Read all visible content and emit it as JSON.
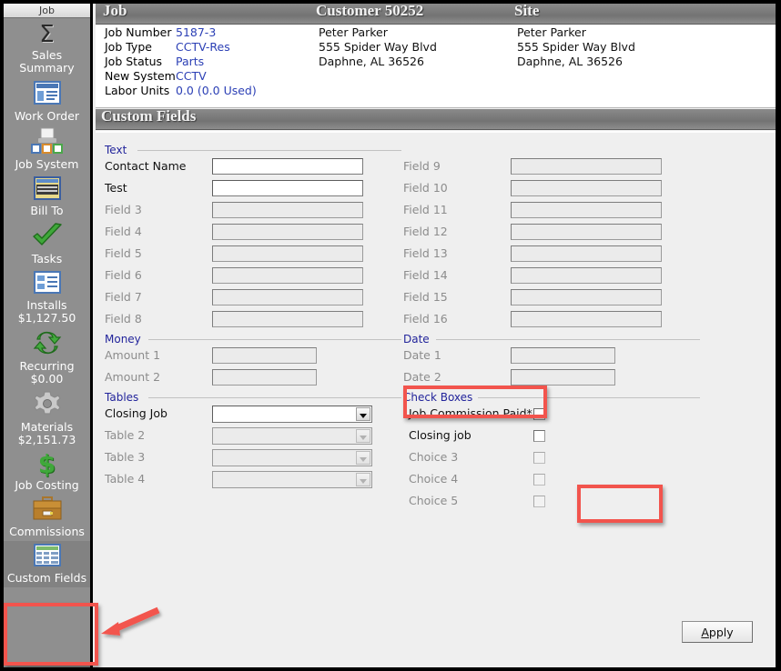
{
  "window": {
    "accent_red": "#f2544d",
    "link_blue": "#2b3fb5",
    "group_blue": "#22249b",
    "sidebar_bg": "#8f8f8f"
  },
  "sidebar": {
    "tab_label": "Job",
    "items": [
      {
        "label": "Sales Summary",
        "sub": "",
        "icon": "sigma-icon",
        "selected": false
      },
      {
        "label": "Work Order",
        "sub": "",
        "icon": "work-order-icon",
        "selected": false
      },
      {
        "label": "Job System",
        "sub": "",
        "icon": "job-system-icon",
        "selected": false
      },
      {
        "label": "Bill To",
        "sub": "",
        "icon": "bill-to-icon",
        "selected": false
      },
      {
        "label": "Tasks",
        "sub": "",
        "icon": "green-check-icon",
        "selected": false
      },
      {
        "label": "Installs",
        "sub": "$1,127.50",
        "icon": "installs-icon",
        "selected": false
      },
      {
        "label": "Recurring",
        "sub": "$0.00",
        "icon": "recurring-arrows-icon",
        "selected": false
      },
      {
        "label": "Materials",
        "sub": "$2,151.73",
        "icon": "gear-icon",
        "selected": false
      },
      {
        "label": "Job Costing",
        "sub": "",
        "icon": "dollar-sign-icon",
        "selected": false
      },
      {
        "label": "Commissions",
        "sub": "",
        "icon": "briefcase-icon",
        "selected": false
      },
      {
        "label": "Custom Fields",
        "sub": "",
        "icon": "table-grid-icon",
        "selected": true
      }
    ]
  },
  "top": {
    "job_header": "Job",
    "customer_header": "Customer 50252",
    "site_header": "Site",
    "job_fields": [
      {
        "key": "Job Number",
        "value": "5187-3"
      },
      {
        "key": "Job Type",
        "value": "CCTV-Res"
      },
      {
        "key": "Job Status",
        "value": "Parts"
      },
      {
        "key": "New System",
        "value": "CCTV"
      },
      {
        "key": "Labor Units",
        "value": "0.0 (0.0 Used)"
      }
    ],
    "customer_address": [
      "Peter Parker",
      "555 Spider Way Blvd",
      "Daphne, AL  36526"
    ],
    "site_address": [
      "Peter Parker",
      "555 Spider Way Blvd",
      "Daphne, AL  36526"
    ]
  },
  "custom_fields": {
    "panel_title": "Custom Fields",
    "groups": {
      "text": "Text",
      "money": "Money",
      "tables": "Tables",
      "date": "Date",
      "check_boxes": "Check Boxes"
    },
    "text_left": [
      {
        "label": "Contact Name",
        "value": "",
        "enabled": true
      },
      {
        "label": "Test",
        "value": "",
        "enabled": true
      },
      {
        "label": "Field 3",
        "value": "",
        "enabled": false
      },
      {
        "label": "Field 4",
        "value": "",
        "enabled": false
      },
      {
        "label": "Field 5",
        "value": "",
        "enabled": false
      },
      {
        "label": "Field 6",
        "value": "",
        "enabled": false
      },
      {
        "label": "Field 7",
        "value": "",
        "enabled": false
      },
      {
        "label": "Field 8",
        "value": "",
        "enabled": false
      }
    ],
    "text_right": [
      {
        "label": "Field 9",
        "value": "",
        "enabled": false
      },
      {
        "label": "Field 10",
        "value": "",
        "enabled": false
      },
      {
        "label": "Field 11",
        "value": "",
        "enabled": false
      },
      {
        "label": "Field 12",
        "value": "",
        "enabled": false
      },
      {
        "label": "Field 13",
        "value": "",
        "enabled": false
      },
      {
        "label": "Field 14",
        "value": "",
        "enabled": false
      },
      {
        "label": "Field 15",
        "value": "",
        "enabled": false
      },
      {
        "label": "Field 16",
        "value": "",
        "enabled": false
      }
    ],
    "money": [
      {
        "label": "Amount 1",
        "value": "",
        "enabled": false
      },
      {
        "label": "Amount 2",
        "value": "",
        "enabled": false
      }
    ],
    "dates": [
      {
        "label": "Date 1",
        "value": "",
        "enabled": false
      },
      {
        "label": "Date 2",
        "value": "",
        "enabled": false
      }
    ],
    "tables": [
      {
        "label": "Closing Job",
        "value": "",
        "enabled": true
      },
      {
        "label": "Table 2",
        "value": "",
        "enabled": false
      },
      {
        "label": "Table 3",
        "value": "",
        "enabled": false
      },
      {
        "label": "Table 4",
        "value": "",
        "enabled": false
      }
    ],
    "checkboxes": [
      {
        "label": "Job Commission Paid*",
        "checked": false,
        "enabled": true
      },
      {
        "label": "Closing job",
        "checked": false,
        "enabled": true
      },
      {
        "label": "Choice 3",
        "checked": false,
        "enabled": false
      },
      {
        "label": "Choice 4",
        "checked": false,
        "enabled": false
      },
      {
        "label": "Choice 5",
        "checked": false,
        "enabled": false
      }
    ],
    "apply_button": "Apply",
    "apply_accel": "A"
  }
}
